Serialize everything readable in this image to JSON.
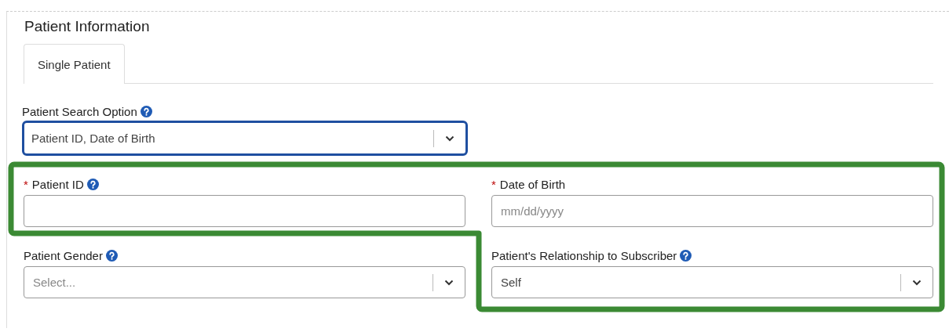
{
  "section": {
    "title": "Patient Information"
  },
  "tabs": [
    {
      "label": "Single Patient",
      "selected": true
    }
  ],
  "rows": [
    [
      {
        "kind": "select",
        "label": "Patient Search Option",
        "help": true,
        "value": "Patient ID, Date of Birth",
        "focused": true
      }
    ],
    [
      {
        "kind": "text",
        "required_mark": "*",
        "label": "Patient ID",
        "help": true,
        "focused": false
      },
      {
        "kind": "text",
        "required_mark": "*",
        "label": "Date of Birth",
        "help": false,
        "placeholder": "mm/dd/yyyy",
        "focused": false
      }
    ],
    [
      {
        "kind": "select",
        "label": "Patient Gender",
        "help": true,
        "placeholder": "Select...",
        "focused": false
      },
      {
        "kind": "select",
        "label": "Patient's Relationship to Subscriber",
        "help": true,
        "value": "Self",
        "focused": false
      }
    ]
  ],
  "highlight_outline": true
}
